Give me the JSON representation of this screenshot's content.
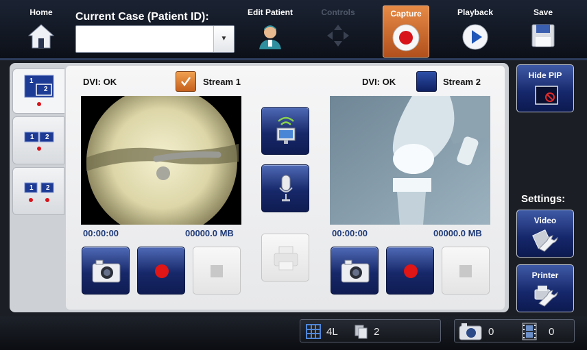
{
  "topbar": {
    "home_label": "Home",
    "case_label": "Current Case (Patient ID):",
    "case_value": "",
    "edit_patient_label": "Edit Patient",
    "controls_label": "Controls",
    "capture_label": "Capture",
    "playback_label": "Playback",
    "save_label": "Save"
  },
  "streams": [
    {
      "dvi": "DVI: OK",
      "name": "Stream 1",
      "checked": true,
      "time": "00:00:00",
      "size": "00000.0 MB"
    },
    {
      "dvi": "DVI: OK",
      "name": "Stream 2",
      "checked": false,
      "time": "00:00:00",
      "size": "00000.0 MB"
    }
  ],
  "layouts": [
    {
      "id": "pip",
      "label_a": "1",
      "label_b": "2"
    },
    {
      "id": "side-by-side",
      "label_a": "1",
      "label_b": "2"
    },
    {
      "id": "split",
      "label_a": "1",
      "label_b": "2"
    }
  ],
  "side": {
    "hide_pip_label": "Hide PIP",
    "settings_label": "Settings:",
    "video_label": "Video",
    "printer_label": "Printer"
  },
  "status": {
    "layout_value": "4L",
    "copies_value": "2",
    "photo_count": "0",
    "video_count": "0"
  },
  "colors": {
    "accent": "#c9601f",
    "button_blue": "#1b2d74",
    "record_red": "#e01515"
  }
}
